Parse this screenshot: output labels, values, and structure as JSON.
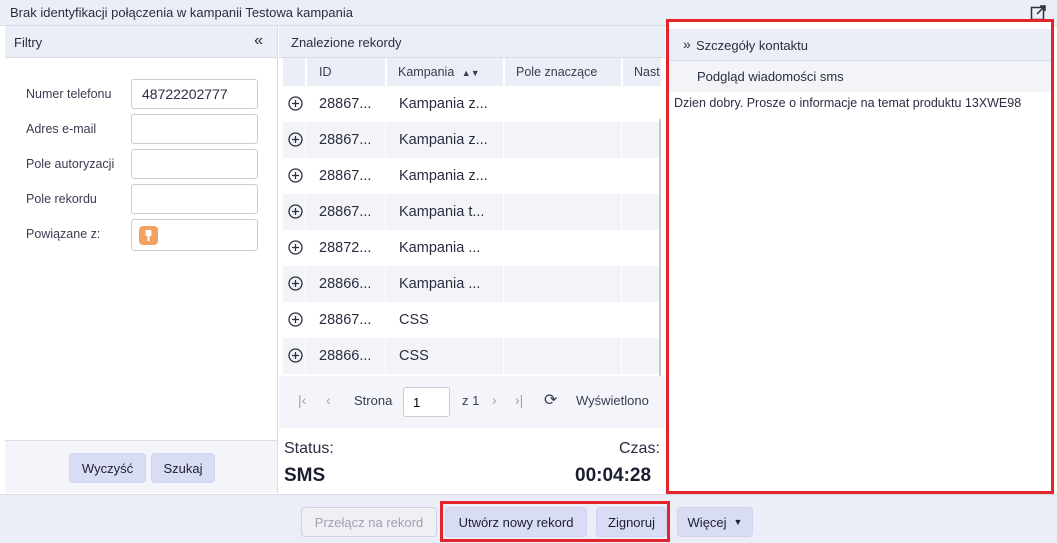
{
  "window": {
    "title": "Brak identyfikacji połączenia w kampanii Testowa kampania",
    "popout_icon": "popout-icon"
  },
  "filters": {
    "title": "Filtry",
    "collapse_icon": "double-chevron-left-icon",
    "phone": {
      "label": "Numer telefonu",
      "value": "48722202777"
    },
    "email": {
      "label": "Adres e-mail",
      "value": ""
    },
    "auth": {
      "label": "Pole autoryzacji",
      "value": ""
    },
    "record": {
      "label": "Pole rekordu",
      "value": ""
    },
    "related": {
      "label": "Powiązane z:",
      "icon": "contact-card-icon"
    },
    "clear_label": "Wyczyść",
    "search_label": "Szukaj"
  },
  "records": {
    "title": "Znalezione rekordy",
    "columns": [
      "ID",
      "Kampania",
      "Pole znaczące",
      "Nast"
    ],
    "sort_icon": "sort-icon",
    "rows": [
      {
        "id": "28867...",
        "campaign": "Kampania z...",
        "field": ""
      },
      {
        "id": "28867...",
        "campaign": "Kampania z...",
        "field": ""
      },
      {
        "id": "28867...",
        "campaign": "Kampania z...",
        "field": ""
      },
      {
        "id": "28867...",
        "campaign": "Kampania t...",
        "field": ""
      },
      {
        "id": "28872...",
        "campaign": "Kampania ...",
        "field": ""
      },
      {
        "id": "28866...",
        "campaign": "Kampania ...",
        "field": ""
      },
      {
        "id": "28867...",
        "campaign": "CSS",
        "field": ""
      },
      {
        "id": "28866...",
        "campaign": "CSS",
        "field": ""
      }
    ],
    "pager": {
      "page_label": "Strona",
      "page": "1",
      "of_label": "z 1",
      "display_label": "Wyświetlono"
    },
    "status_label": "Status:",
    "status_value": "SMS",
    "time_label": "Czas:",
    "time_value": "00:04:28"
  },
  "details": {
    "title": "Szczegóły kontaktu",
    "expand_icon": "double-chevron-right-icon",
    "sms_preview_title": "Podgląd wiadomości sms",
    "message": "Dzien dobry. Prosze o informacje na temat produktu 13XWE98"
  },
  "footer": {
    "switch_label": "Przełącz na rekord",
    "create_label": "Utwórz nowy rekord",
    "ignore_label": "Zignoruj",
    "more_label": "Więcej"
  },
  "colors": {
    "accent": "#d9dcf5",
    "highlight": "#e3242b",
    "header_bg": "#eceef7",
    "badge": "#f4a261"
  }
}
